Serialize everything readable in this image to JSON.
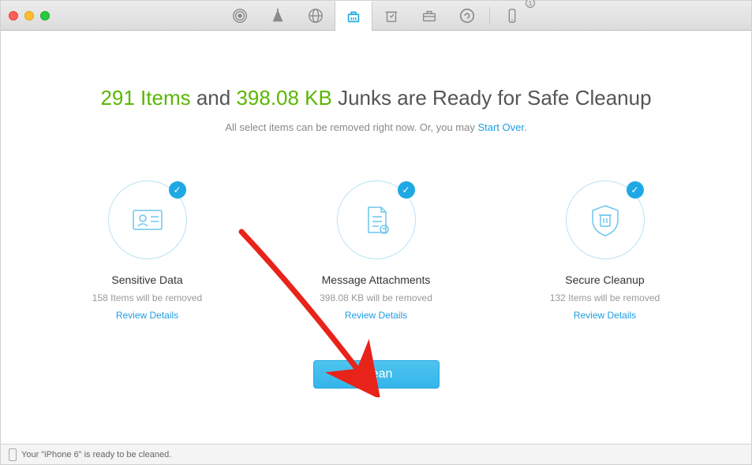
{
  "headline": {
    "items_count": "291 Items",
    "and": " and ",
    "size": "398.08 KB",
    "rest": " Junks are Ready for Safe Cleanup"
  },
  "subline": {
    "text": "All select items can be removed right now. Or, you may ",
    "link": "Start Over",
    "end": "."
  },
  "cards": [
    {
      "title": "Sensitive Data",
      "sub": "158 Items will be removed",
      "link": "Review Details"
    },
    {
      "title": "Message Attachments",
      "sub": "398.08 KB will be removed",
      "link": "Review Details"
    },
    {
      "title": "Secure Cleanup",
      "sub": "132 Items will be removed",
      "link": "Review Details"
    }
  ],
  "clean_button": "Clean",
  "status": "Your \"iPhone 6\" is ready to be cleaned.",
  "device_badge": "1",
  "check": "✓"
}
